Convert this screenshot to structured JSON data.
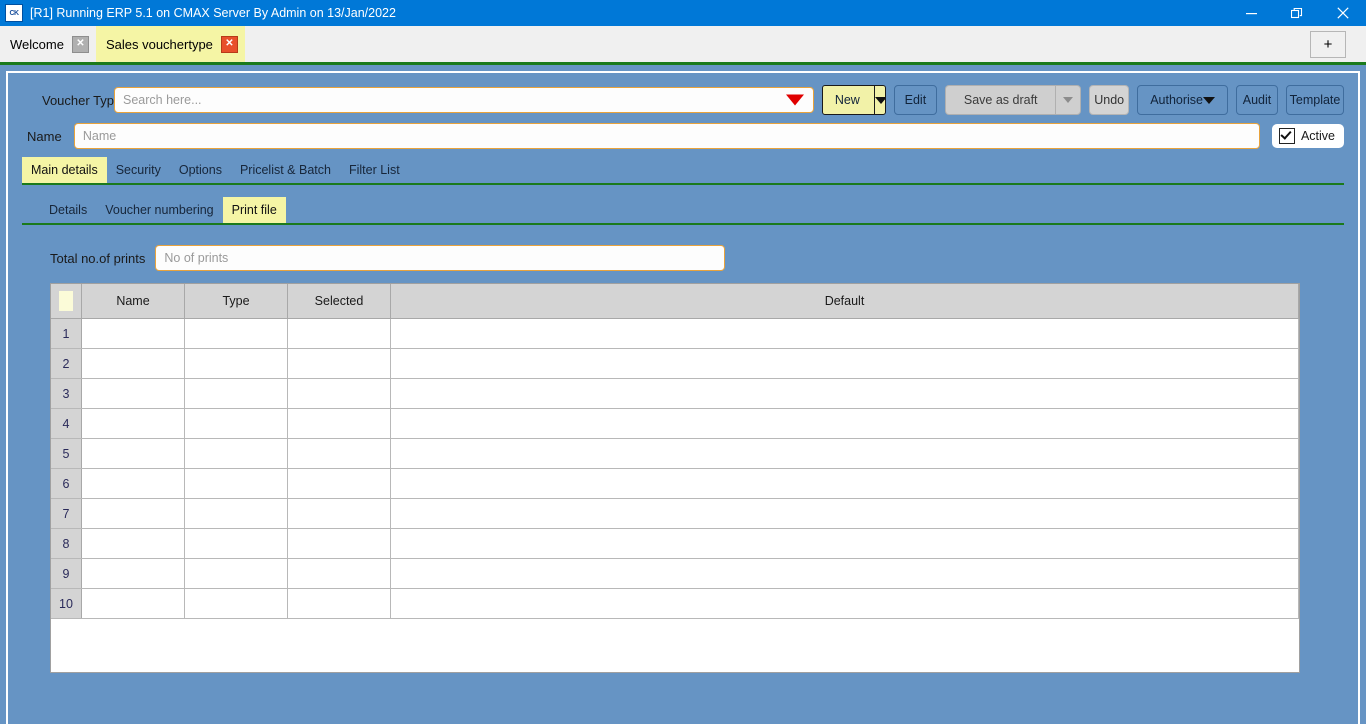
{
  "window": {
    "title": "[R1] Running ERP 5.1 on CMAX Server By Admin on 13/Jan/2022",
    "app_icon_text": "CK",
    "minimize_icon": "minimize-icon",
    "restore_icon": "restore-icon",
    "close_icon": "close-icon",
    "titlebar_color": "#0078d7"
  },
  "tabbar": {
    "tabs": [
      {
        "label": "Welcome",
        "active": false,
        "close_icon": "close-icon"
      },
      {
        "label": "Sales vouchertype",
        "active": true,
        "close_icon": "close-icon"
      }
    ],
    "add_tab_label": "+"
  },
  "toolbar": {
    "voucher_type_label": "Voucher Type",
    "search_placeholder": "Search here...",
    "search_value": "",
    "dropdown_icon": "dropdown-triangle-icon",
    "new_label": "New",
    "new_dropdown_icon": "chevron-down-icon",
    "edit_label": "Edit",
    "save_as_draft_label": "Save as draft",
    "save_dropdown_icon": "chevron-down-icon",
    "undo_label": "Undo",
    "authorise_label": "Authorise",
    "authorise_dropdown_icon": "chevron-down-icon",
    "audit_label": "Audit",
    "template_label": "Template"
  },
  "name_row": {
    "label": "Name",
    "placeholder": "Name",
    "value": "",
    "active_label": "Active",
    "active_checked": true
  },
  "main_tabs": [
    {
      "label": "Main details",
      "active": true
    },
    {
      "label": "Security",
      "active": false
    },
    {
      "label": "Options",
      "active": false
    },
    {
      "label": "Pricelist & Batch",
      "active": false
    },
    {
      "label": "Filter List",
      "active": false
    }
  ],
  "sub_tabs": [
    {
      "label": "Details",
      "active": false
    },
    {
      "label": "Voucher numbering",
      "active": false
    },
    {
      "label": "Print file",
      "active": true
    }
  ],
  "print_file": {
    "total_prints_label": "Total no.of prints",
    "total_prints_placeholder": "No of prints",
    "total_prints_value": "",
    "grid": {
      "columns": [
        "",
        "Name",
        "Type",
        "Selected",
        "Default"
      ],
      "rows": [
        {
          "num": "1",
          "name": "",
          "type": "",
          "selected": "",
          "default": ""
        },
        {
          "num": "2",
          "name": "",
          "type": "",
          "selected": "",
          "default": ""
        },
        {
          "num": "3",
          "name": "",
          "type": "",
          "selected": "",
          "default": ""
        },
        {
          "num": "4",
          "name": "",
          "type": "",
          "selected": "",
          "default": ""
        },
        {
          "num": "5",
          "name": "",
          "type": "",
          "selected": "",
          "default": ""
        },
        {
          "num": "6",
          "name": "",
          "type": "",
          "selected": "",
          "default": ""
        },
        {
          "num": "7",
          "name": "",
          "type": "",
          "selected": "",
          "default": ""
        },
        {
          "num": "8",
          "name": "",
          "type": "",
          "selected": "",
          "default": ""
        },
        {
          "num": "9",
          "name": "",
          "type": "",
          "selected": "",
          "default": ""
        },
        {
          "num": "10",
          "name": "",
          "type": "",
          "selected": "",
          "default": ""
        }
      ]
    }
  },
  "theme": {
    "panel_blue": "#6694c4",
    "accent_green": "#1b7a1b",
    "tab_active_yellow": "#f5f5a5",
    "input_border_gold": "#e8a33d",
    "header_gray": "#d4d4d4"
  }
}
